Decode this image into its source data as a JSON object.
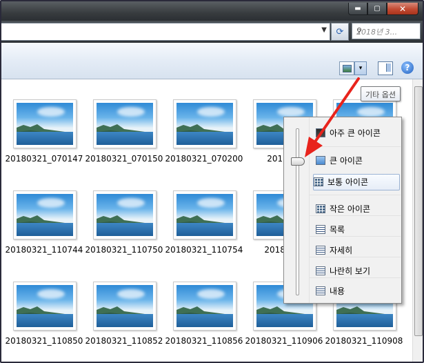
{
  "window": {
    "title_buttons": {
      "minimize": "▬",
      "maximize": "▢",
      "close": "✕"
    }
  },
  "address": {
    "path_value": "",
    "dropdown_glyph": "▼",
    "refresh_glyph": "⟳",
    "search_placeholder": "2018년 3...",
    "search_glyph": "⚲"
  },
  "toolbar": {
    "view_dropdown_glyph": "▾",
    "help_glyph": "?"
  },
  "tooltip": {
    "text": "기타 옵션"
  },
  "files": [
    {
      "name": "20180321_070147"
    },
    {
      "name": "20180321_070150"
    },
    {
      "name": "20180321_070200"
    },
    {
      "name": "20180..."
    },
    {
      "name": ""
    },
    {
      "name": "20180321_110744"
    },
    {
      "name": "20180321_110750"
    },
    {
      "name": "20180321_110754"
    },
    {
      "name": "201803..."
    },
    {
      "name": ""
    },
    {
      "name": "20180321_110850"
    },
    {
      "name": "20180321_110852"
    },
    {
      "name": "20180321_110856"
    },
    {
      "name": "20180321_110906"
    },
    {
      "name": "20180321_110908"
    }
  ],
  "view_menu": {
    "items": [
      {
        "label": "아주 큰 아이콘",
        "icon": "extra-large-icons-icon"
      },
      {
        "label": "큰 아이콘",
        "icon": "large-icons-icon"
      },
      {
        "label": "보통 아이콘",
        "icon": "medium-icons-icon",
        "selected": true
      },
      {
        "label": "작은 아이콘",
        "icon": "small-icons-icon"
      },
      {
        "label": "목록",
        "icon": "list-icon"
      },
      {
        "label": "자세히",
        "icon": "details-icon"
      },
      {
        "label": "나란히 보기",
        "icon": "tiles-icon"
      },
      {
        "label": "내용",
        "icon": "content-icon"
      }
    ]
  },
  "colors": {
    "arrow": "#e8231c",
    "selection_border": "#9bb3d3",
    "toolbar_top": "#f6f9fd"
  }
}
